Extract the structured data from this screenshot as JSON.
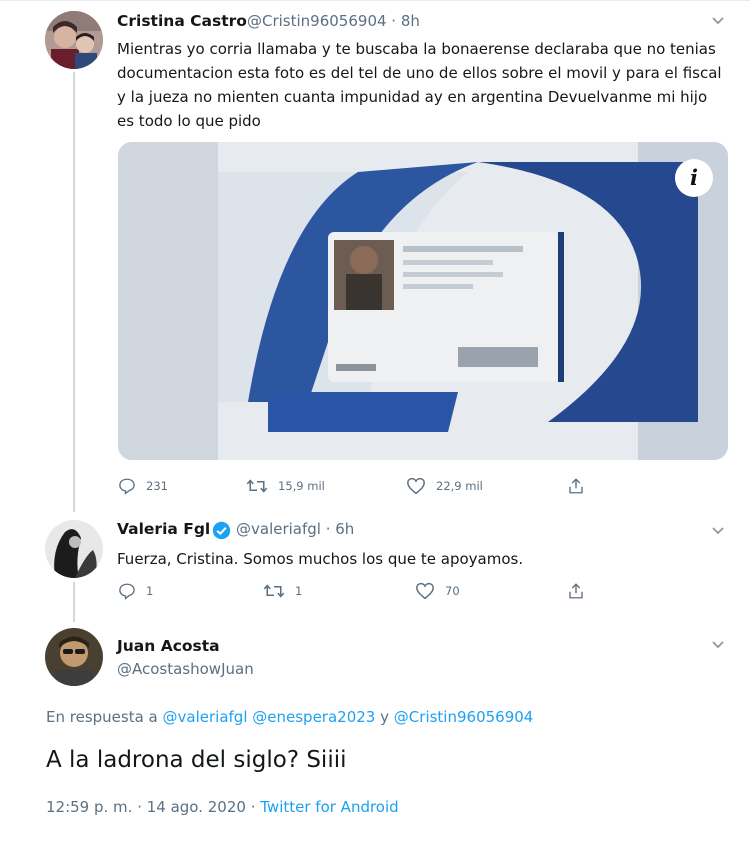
{
  "tweet1": {
    "name": "Cristina Castro",
    "handle": "@Cristin96056904 · 8h",
    "text": "Mientras yo corria llamaba y te buscaba la bonaerense declaraba que no tenias documentacion esta foto es del tel de uno de ellos sobre el movil y para el fiscal y la jueza no mienten cuanta impunidad ay en argentina Devuelvanme mi hijo es todo lo que pido",
    "media_info": "i",
    "replies": "231",
    "retweets": "15,9 mil",
    "likes": "22,9 mil"
  },
  "tweet2": {
    "name": "Valeria Fgl",
    "handle": "@valeriafgl · 6h",
    "text": "Fuerza, Cristina. Somos muchos los que te apoyamos.",
    "replies": "1",
    "retweets": "1",
    "likes": "70"
  },
  "tweet3": {
    "name": "Juan Acosta",
    "handle": "@AcostashowJuan",
    "reply_prefix": "En respuesta a",
    "mention1": "@valeriafgl",
    "mention2": "@enespera2023",
    "conj": "y",
    "mention3": "@Cristin96056904",
    "text": "A la ladrona del siglo? Siiii",
    "time": "12:59 p. m. · 14 ago. 2020 ·",
    "source": "Twitter for Android"
  },
  "icons": [
    "chevron-down-icon",
    "reply-icon",
    "retweet-icon",
    "like-icon",
    "share-icon",
    "verified-icon",
    "info-icon"
  ],
  "colors": {
    "accent": "#1da1f2",
    "muted": "#5b7083",
    "text": "#14171a"
  }
}
